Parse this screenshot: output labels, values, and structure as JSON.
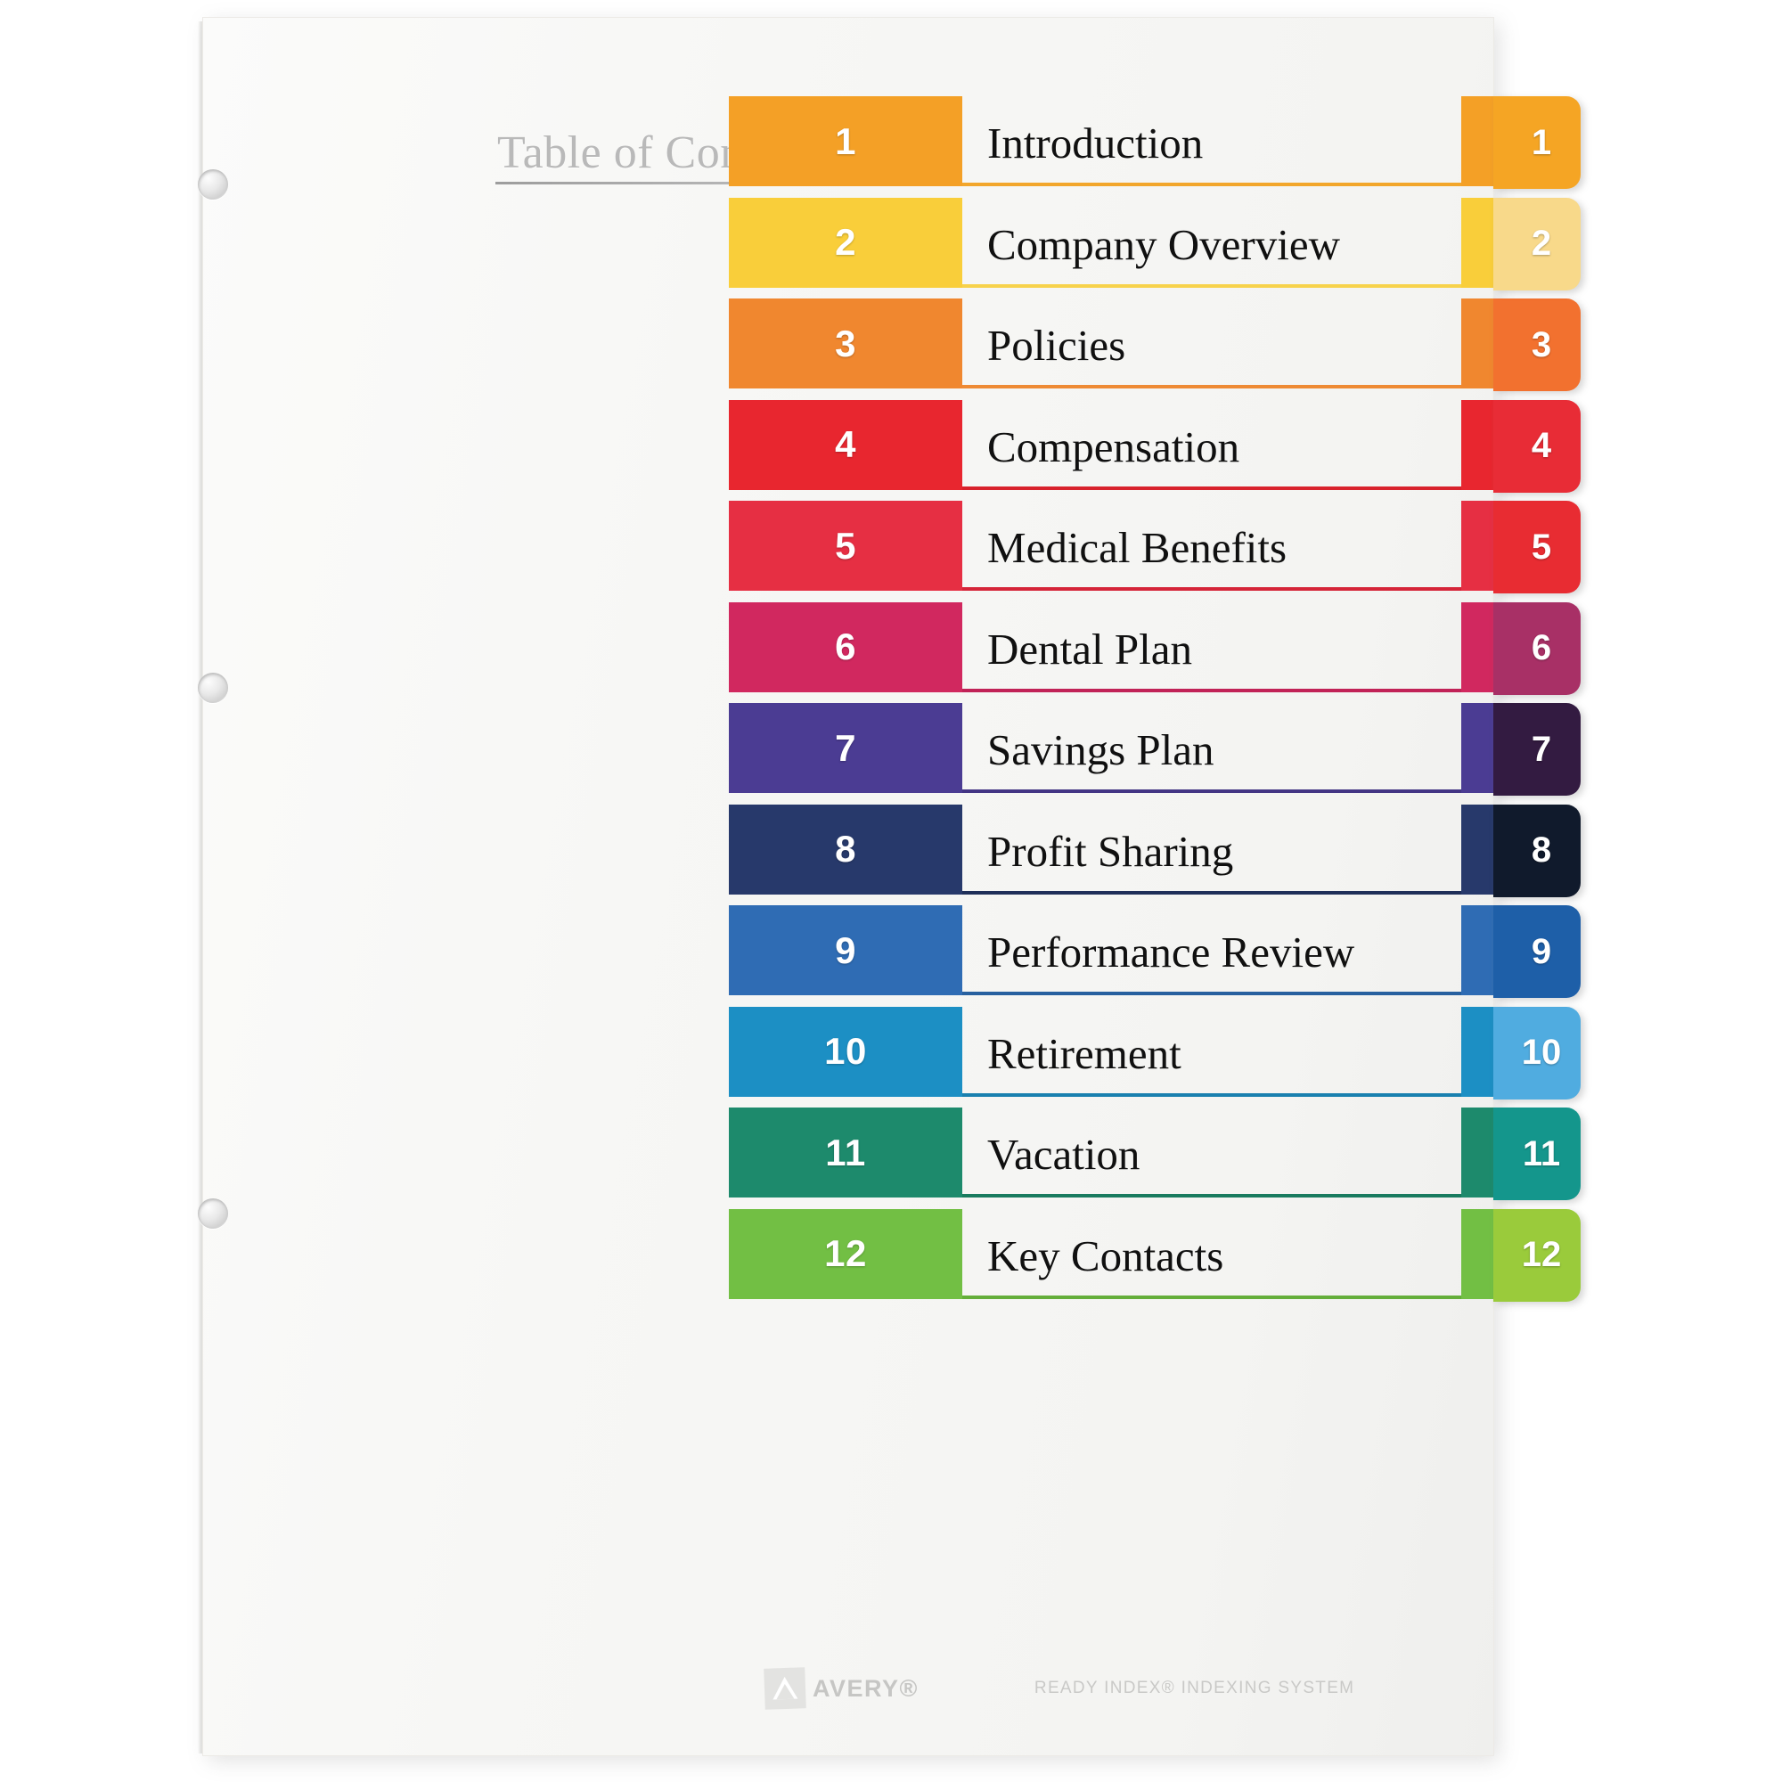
{
  "document": {
    "title": "Table of Contents",
    "kind": "avery-ready-index-divider-set"
  },
  "footer": {
    "brand": "AVERY®",
    "brand_icon": "avery-triangle-logo",
    "system_label": "READY INDEX® INDEXING SYSTEM"
  },
  "holes": [
    {
      "name": "punch-hole-top"
    },
    {
      "name": "punch-hole-middle"
    },
    {
      "name": "punch-hole-bottom"
    }
  ],
  "contents": [
    {
      "number": "1",
      "label": "Introduction",
      "block_color": "#F4A026",
      "rule_color": "#F2A62B",
      "tab_color": "#F5A524",
      "edge_color": "#F4A026"
    },
    {
      "number": "2",
      "label": "Company Overview",
      "block_color": "#F9CE3A",
      "rule_color": "#F7D24B",
      "tab_color": "#F8D98A",
      "edge_color": "#F9CE3A"
    },
    {
      "number": "3",
      "label": "Policies",
      "block_color": "#F0872F",
      "rule_color": "#EE8A34",
      "tab_color": "#F2712F",
      "edge_color": "#F0872F"
    },
    {
      "number": "4",
      "label": "Compensation",
      "block_color": "#E8262F",
      "rule_color": "#D8222C",
      "tab_color": "#E82C36",
      "edge_color": "#E8262F"
    },
    {
      "number": "5",
      "label": "Medical Benefits",
      "block_color": "#E62F43",
      "rule_color": "#D52438",
      "tab_color": "#E82C32",
      "edge_color": "#E62F43"
    },
    {
      "number": "6",
      "label": "Dental Plan",
      "block_color": "#D1285F",
      "rule_color": "#C12257",
      "tab_color": "#A83066",
      "edge_color": "#D1285F"
    },
    {
      "number": "7",
      "label": "Savings Plan",
      "block_color": "#4B3C93",
      "rule_color": "#433584",
      "tab_color": "#331B41",
      "edge_color": "#4B3C93"
    },
    {
      "number": "8",
      "label": "Profit Sharing",
      "block_color": "#27396B",
      "rule_color": "#1F2F59",
      "tab_color": "#101A2C",
      "edge_color": "#27396B"
    },
    {
      "number": "9",
      "label": "Performance Review",
      "block_color": "#2F6CB4",
      "rule_color": "#27609F",
      "tab_color": "#1E5FA8",
      "edge_color": "#2F6CB4"
    },
    {
      "number": "10",
      "label": "Retirement",
      "block_color": "#1C8FC4",
      "rule_color": "#1980AF",
      "tab_color": "#50ACE0",
      "edge_color": "#1C8FC4"
    },
    {
      "number": "11",
      "label": "Vacation",
      "block_color": "#1D8A6C",
      "rule_color": "#197B5F",
      "tab_color": "#14968C",
      "edge_color": "#1D8A6C"
    },
    {
      "number": "12",
      "label": "Key Contacts",
      "block_color": "#72BF44",
      "rule_color": "#64AE3A",
      "tab_color": "#9ACB3B",
      "edge_color": "#72BF44"
    }
  ]
}
